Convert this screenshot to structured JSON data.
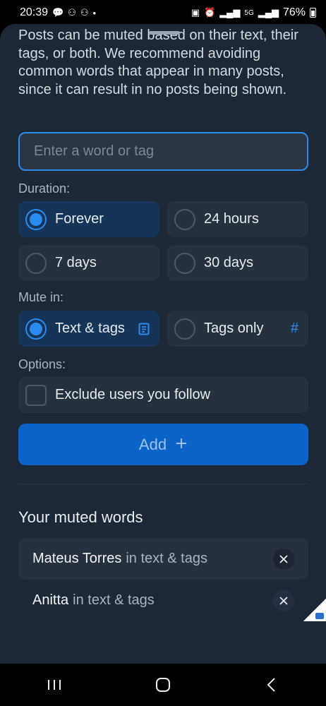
{
  "status_bar": {
    "time": "20:39",
    "battery": "76%",
    "network": "5G"
  },
  "intro_text": "Posts can be muted based on their text, their tags, or both. We recommend avoiding common words that appear in many posts, since it can result in no posts being shown.",
  "input": {
    "placeholder": "Enter a word or tag",
    "value": ""
  },
  "duration": {
    "label": "Duration:",
    "options": [
      {
        "label": "Forever",
        "selected": true
      },
      {
        "label": "24 hours",
        "selected": false
      },
      {
        "label": "7 days",
        "selected": false
      },
      {
        "label": "30 days",
        "selected": false
      }
    ]
  },
  "mute_in": {
    "label": "Mute in:",
    "options": [
      {
        "label": "Text & tags",
        "selected": true,
        "icon": "document-icon"
      },
      {
        "label": "Tags only",
        "selected": false,
        "icon": "hashtag-icon"
      }
    ]
  },
  "options": {
    "label": "Options:",
    "exclude_following": {
      "label": "Exclude users you follow",
      "checked": false
    }
  },
  "add_button": {
    "label": "Add",
    "icon": "plus-icon"
  },
  "muted_words": {
    "title": "Your muted words",
    "items": [
      {
        "word": "Mateus Torres",
        "scope": "in text & tags"
      },
      {
        "word": "Anitta",
        "scope": "in text & tags"
      }
    ]
  },
  "colors": {
    "accent": "#2a8cf0",
    "sheet_bg": "#1c2836",
    "selected_bg": "#163458",
    "button_bg": "#0c63c9"
  }
}
